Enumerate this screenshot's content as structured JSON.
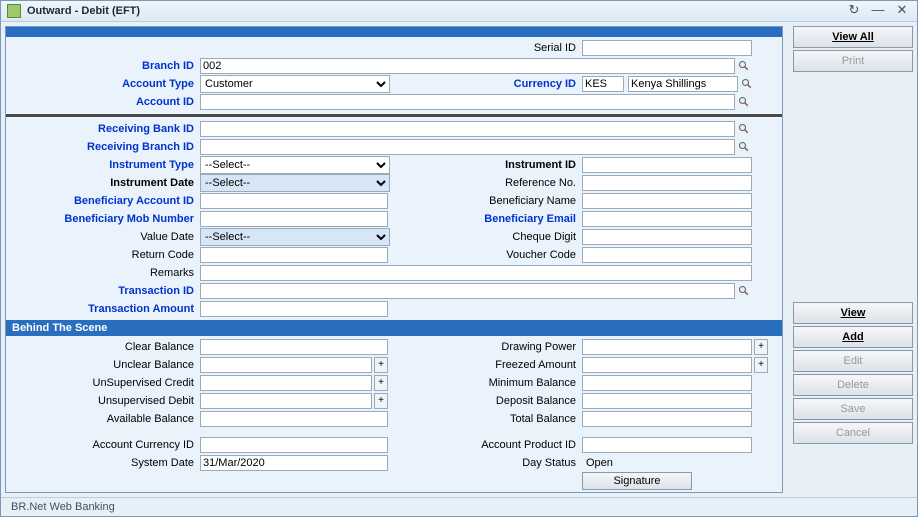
{
  "window": {
    "title": "Outward - Debit (EFT)"
  },
  "top": {
    "serial_lbl": "Serial ID",
    "serial_val": "",
    "branch_lbl": "Branch ID",
    "branch_val": "002",
    "acctype_lbl": "Account Type",
    "acctype_val": "Customer",
    "currency_lbl": "Currency ID",
    "currency_code": "KES",
    "currency_name": "Kenya Shillings",
    "accid_lbl": "Account ID",
    "accid_val": ""
  },
  "recv": {
    "bank_lbl": "Receiving Bank ID",
    "bank_val": "",
    "branch_lbl": "Receiving Branch ID",
    "branch_val": "",
    "insttype_lbl": "Instrument Type",
    "insttype_val": "--Select--",
    "instid_lbl": "Instrument ID",
    "instid_val": "",
    "instdate_lbl": "Instrument Date",
    "instdate_val": "--Select--",
    "refno_lbl": "Reference No.",
    "refno_val": "",
    "benacc_lbl": "Beneficiary Account ID",
    "benacc_val": "",
    "benname_lbl": "Beneficiary Name",
    "benname_val": "",
    "benmob_lbl": "Beneficiary Mob Number",
    "benmob_val": "",
    "benemail_lbl": "Beneficiary Email",
    "benemail_val": "",
    "valdate_lbl": "Value Date",
    "valdate_val": "--Select--",
    "chqdigit_lbl": "Cheque Digit",
    "chqdigit_val": "",
    "retcode_lbl": "Return Code",
    "retcode_val": "",
    "voucher_lbl": "Voucher Code",
    "voucher_val": "",
    "remarks_lbl": "Remarks",
    "remarks_val": "",
    "txid_lbl": "Transaction ID",
    "txid_val": "",
    "txamt_lbl": "Transaction Amount",
    "txamt_val": ""
  },
  "bts": {
    "header": "Behind The Scene",
    "clearbal_lbl": "Clear Balance",
    "clearbal_val": "",
    "drawpow_lbl": "Drawing Power",
    "drawpow_val": "",
    "unclear_lbl": "Unclear Balance",
    "unclear_val": "",
    "freezed_lbl": "Freezed Amount",
    "freezed_val": "",
    "unsupcr_lbl": "UnSupervised Credit",
    "unsupcr_val": "",
    "minbal_lbl": "Minimum Balance",
    "minbal_val": "",
    "unsupdb_lbl": "Unsupervised Debit",
    "unsupdb_val": "",
    "depbal_lbl": "Deposit Balance",
    "depbal_val": "",
    "availbal_lbl": "Available Balance",
    "availbal_val": "",
    "totbal_lbl": "Total Balance",
    "totbal_val": "",
    "acccur_lbl": "Account Currency ID",
    "acccur_val": "",
    "accprod_lbl": "Account Product ID",
    "accprod_val": "",
    "sysdate_lbl": "System Date",
    "sysdate_val": "31/Mar/2020",
    "daystat_lbl": "Day Status",
    "daystat_val": "Open",
    "signature_btn": "Signature"
  },
  "side": {
    "viewall": "View All",
    "print": "Print",
    "view": "View",
    "add": "Add",
    "edit": "Edit",
    "delete": "Delete",
    "save": "Save",
    "cancel": "Cancel"
  },
  "status": "BR.Net Web Banking"
}
